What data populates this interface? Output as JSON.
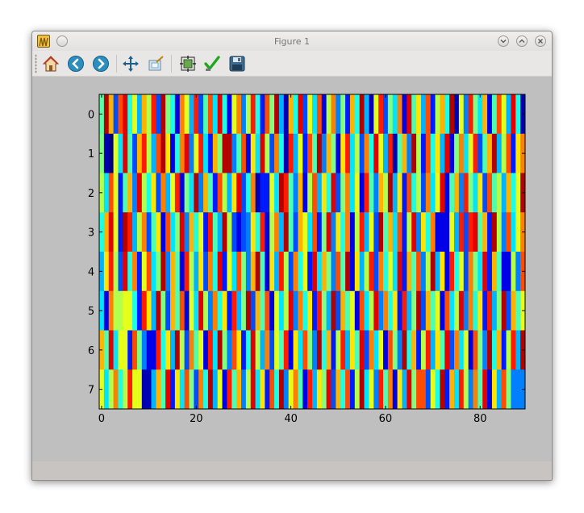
{
  "window": {
    "title": "Figure 1"
  },
  "toolbar": {
    "buttons": [
      {
        "name": "home-button",
        "icon": "home-icon"
      },
      {
        "name": "back-button",
        "icon": "arrow-left-icon"
      },
      {
        "name": "forward-button",
        "icon": "arrow-right-icon"
      },
      {
        "name": "pan-button",
        "icon": "move-icon"
      },
      {
        "name": "zoom-button",
        "icon": "zoom-rect-icon"
      },
      {
        "name": "subplots-button",
        "icon": "subplots-icon"
      },
      {
        "name": "edit-axis-button",
        "icon": "checkmark-icon"
      },
      {
        "name": "save-button",
        "icon": "floppy-disk-icon"
      }
    ]
  },
  "chart_data": {
    "type": "heatmap",
    "colormap": "jet",
    "rows": 8,
    "cols": 90,
    "vmin": 0,
    "vmax": 1,
    "x_ticks": [
      0,
      20,
      40,
      60,
      80
    ],
    "y_ticks": [
      0,
      1,
      2,
      3,
      4,
      5,
      6,
      7
    ],
    "xlim": [
      -0.5,
      89.5
    ],
    "ylim": [
      7.5,
      -0.5
    ],
    "values": [
      [
        0.46,
        0.95,
        0.7,
        0.2,
        0.8,
        0.9,
        0.4,
        0.6,
        0.3,
        0.7,
        0.55,
        0.85,
        0.2,
        0.95,
        0.5,
        0.4,
        0.1,
        0.75,
        0.6,
        0.3,
        0.85,
        0.2,
        0.45,
        0.8,
        0.35,
        0.9,
        0.4,
        0.1,
        0.6,
        0.75,
        0.25,
        0.55,
        0.85,
        0.4,
        0.15,
        0.8,
        0.5,
        0.95,
        0.3,
        0.05,
        0.7,
        0.4,
        0.9,
        0.2,
        0.6,
        0.35,
        0.8,
        0.1,
        0.55,
        0.75,
        0.25,
        0.5,
        0.15,
        0.7,
        0.4,
        0.95,
        0.3,
        0.05,
        0.6,
        0.85,
        0.2,
        0.5,
        0.35,
        0.75,
        0.1,
        0.9,
        0.45,
        0.65,
        0.3,
        0.8,
        0.15,
        0.55,
        0.7,
        0.4,
        0.95,
        0.05,
        0.6,
        0.25,
        0.85,
        0.5,
        0.35,
        0.7,
        0.1,
        0.45,
        0.8,
        0.6,
        0.3,
        0.9,
        0.4,
        0.05
      ],
      [
        0.5,
        0.05,
        0.0,
        0.6,
        0.35,
        0.9,
        0.45,
        0.2,
        0.7,
        0.85,
        0.55,
        0.3,
        0.8,
        0.95,
        0.65,
        0.1,
        0.4,
        0.75,
        0.9,
        0.25,
        0.6,
        0.85,
        0.35,
        0.15,
        0.7,
        0.5,
        0.95,
        0.95,
        0.25,
        0.45,
        0.8,
        0.1,
        0.65,
        0.35,
        0.9,
        0.55,
        0.2,
        0.75,
        0.4,
        0.05,
        0.85,
        0.3,
        0.6,
        0.15,
        0.8,
        0.45,
        0.95,
        0.25,
        0.7,
        0.5,
        0.1,
        0.65,
        0.85,
        0.35,
        0.55,
        0.2,
        0.75,
        0.4,
        0.9,
        0.6,
        0.3,
        0.85,
        0.05,
        0.45,
        0.7,
        0.25,
        0.95,
        0.55,
        0.15,
        0.8,
        0.4,
        0.65,
        0.3,
        0.9,
        0.1,
        0.5,
        0.75,
        0.35,
        0.6,
        0.85,
        0.2,
        0.45,
        0.7,
        0.95,
        0.3,
        0.55,
        0.8,
        0.15,
        0.65,
        0.75
      ],
      [
        0.55,
        0.35,
        0.8,
        0.6,
        0.15,
        0.45,
        0.7,
        0.25,
        0.9,
        0.55,
        0.4,
        0.65,
        0.2,
        0.75,
        0.3,
        0.6,
        0.85,
        0.1,
        0.5,
        0.35,
        0.95,
        0.25,
        0.7,
        0.45,
        0.15,
        0.8,
        0.55,
        0.3,
        0.65,
        0.9,
        0.2,
        0.4,
        0.75,
        0.05,
        0.15,
        0.15,
        0.6,
        0.35,
        0.95,
        0.85,
        0.45,
        0.25,
        0.7,
        0.1,
        0.55,
        0.8,
        0.3,
        0.65,
        0.4,
        0.9,
        0.2,
        0.5,
        0.75,
        0.35,
        0.6,
        0.1,
        0.85,
        0.45,
        0.25,
        0.7,
        0.55,
        0.95,
        0.3,
        0.65,
        0.15,
        0.8,
        0.4,
        0.55,
        0.2,
        0.75,
        0.35,
        0.6,
        0.9,
        0.1,
        0.45,
        0.7,
        0.25,
        0.85,
        0.5,
        0.35,
        0.65,
        0.2,
        0.8,
        0.45,
        0.55,
        0.3,
        0.7,
        0.4,
        0.6,
        0.95
      ],
      [
        0.4,
        0.7,
        0.9,
        0.6,
        0.15,
        0.95,
        0.85,
        0.3,
        0.55,
        0.75,
        0.2,
        0.45,
        0.65,
        0.1,
        0.8,
        0.35,
        0.5,
        0.9,
        0.25,
        0.7,
        0.4,
        0.6,
        0.15,
        0.85,
        0.45,
        0.3,
        0.95,
        0.55,
        0.2,
        0.1,
        0.2,
        0.25,
        0.65,
        0.4,
        0.85,
        0.1,
        0.55,
        0.75,
        0.3,
        0.95,
        0.45,
        0.2,
        0.7,
        0.6,
        0.35,
        0.8,
        0.15,
        0.5,
        0.9,
        0.25,
        0.65,
        0.4,
        0.75,
        0.1,
        0.55,
        0.85,
        0.3,
        0.6,
        0.2,
        0.95,
        0.45,
        0.7,
        0.35,
        0.8,
        0.15,
        0.55,
        0.9,
        0.25,
        0.65,
        0.4,
        0.75,
        0.1,
        0.1,
        0.1,
        0.6,
        0.3,
        0.85,
        0.2,
        0.85,
        0.9,
        0.45,
        0.7,
        0.15,
        0.95,
        0.55,
        0.25,
        0.8,
        0.35,
        0.6,
        0.75
      ],
      [
        0.3,
        0.65,
        0.85,
        0.55,
        0.2,
        0.9,
        0.4,
        0.75,
        0.15,
        0.6,
        0.8,
        0.35,
        0.5,
        0.95,
        0.25,
        0.7,
        0.45,
        0.1,
        0.85,
        0.55,
        0.3,
        0.65,
        0.2,
        0.75,
        0.4,
        0.9,
        0.15,
        0.6,
        0.35,
        0.8,
        0.5,
        0.25,
        0.7,
        0.95,
        0.45,
        0.1,
        0.65,
        0.3,
        0.85,
        0.55,
        0.2,
        0.75,
        0.4,
        0.6,
        0.15,
        0.9,
        0.35,
        0.7,
        0.5,
        0.25,
        0.8,
        0.45,
        0.95,
        0.1,
        0.65,
        0.3,
        0.55,
        0.85,
        0.2,
        0.75,
        0.4,
        0.6,
        0.35,
        0.9,
        0.15,
        0.7,
        0.45,
        0.8,
        0.25,
        0.55,
        0.95,
        0.3,
        0.65,
        0.1,
        0.85,
        0.4,
        0.6,
        0.2,
        0.75,
        0.5,
        0.35,
        0.9,
        0.15,
        0.7,
        0.45,
        0.1,
        0.1,
        0.55,
        0.25,
        0.8
      ],
      [
        0.35,
        0.1,
        0.75,
        0.55,
        0.55,
        0.6,
        0.6,
        0.4,
        0.15,
        0.85,
        0.65,
        0.3,
        0.95,
        0.5,
        0.2,
        0.7,
        0.45,
        0.8,
        0.1,
        0.6,
        0.35,
        0.9,
        0.55,
        0.25,
        0.75,
        0.4,
        0.65,
        0.15,
        0.85,
        0.3,
        0.5,
        0.95,
        0.2,
        0.7,
        0.45,
        0.8,
        0.1,
        0.6,
        0.35,
        0.55,
        0.9,
        0.25,
        0.75,
        0.4,
        0.65,
        0.15,
        0.85,
        0.5,
        0.3,
        0.95,
        0.2,
        0.7,
        0.45,
        0.6,
        0.1,
        0.8,
        0.35,
        0.55,
        0.9,
        0.25,
        0.75,
        0.4,
        0.65,
        0.15,
        0.85,
        0.3,
        0.5,
        0.95,
        0.2,
        0.7,
        0.45,
        0.6,
        0.1,
        0.8,
        0.35,
        0.55,
        0.9,
        0.25,
        0.75,
        0.4,
        0.65,
        0.15,
        0.85,
        0.3,
        0.5,
        0.95,
        0.2,
        0.7,
        0.45,
        0.6
      ],
      [
        0.7,
        0.45,
        0.9,
        0.35,
        0.6,
        0.6,
        0.15,
        0.8,
        0.5,
        0.25,
        0.1,
        0.1,
        0.85,
        0.4,
        0.65,
        0.3,
        0.95,
        0.55,
        0.2,
        0.75,
        0.45,
        0.6,
        0.1,
        0.85,
        0.35,
        0.95,
        0.5,
        0.25,
        0.8,
        0.65,
        0.15,
        0.4,
        0.9,
        0.55,
        0.3,
        0.75,
        0.2,
        0.6,
        0.45,
        0.85,
        0.1,
        0.65,
        0.35,
        0.8,
        0.5,
        0.25,
        0.95,
        0.4,
        0.7,
        0.15,
        0.55,
        0.85,
        0.3,
        0.65,
        0.45,
        0.9,
        0.2,
        0.75,
        0.35,
        0.6,
        0.1,
        0.8,
        0.5,
        0.25,
        0.95,
        0.4,
        0.7,
        0.15,
        0.55,
        0.85,
        0.3,
        0.65,
        0.45,
        0.9,
        0.2,
        0.75,
        0.35,
        0.6,
        0.1,
        0.8,
        0.5,
        0.25,
        0.95,
        0.4,
        0.7,
        0.15,
        0.55,
        0.85,
        0.3,
        0.95
      ],
      [
        0.6,
        0.35,
        0.55,
        0.75,
        0.4,
        0.55,
        0.85,
        0.6,
        0.6,
        0.05,
        0.05,
        0.3,
        0.7,
        0.45,
        0.9,
        0.15,
        0.65,
        0.35,
        0.8,
        0.5,
        0.2,
        0.75,
        0.4,
        0.95,
        0.3,
        0.6,
        0.1,
        0.85,
        0.45,
        0.7,
        0.25,
        0.55,
        0.9,
        0.35,
        0.65,
        0.15,
        0.8,
        0.4,
        0.95,
        0.25,
        0.6,
        0.75,
        0.45,
        0.1,
        0.85,
        0.3,
        0.65,
        0.5,
        0.9,
        0.2,
        0.7,
        0.4,
        0.8,
        0.15,
        0.55,
        0.95,
        0.35,
        0.6,
        0.25,
        0.85,
        0.45,
        0.75,
        0.1,
        0.65,
        0.3,
        0.9,
        0.5,
        0.8,
        0.8,
        0.2,
        0.6,
        0.4,
        0.95,
        0.15,
        0.7,
        0.35,
        0.85,
        0.55,
        0.25,
        0.75,
        0.45,
        0.9,
        0.1,
        0.65,
        0.3,
        0.8,
        0.5,
        0.25,
        0.25,
        0.25
      ]
    ]
  }
}
